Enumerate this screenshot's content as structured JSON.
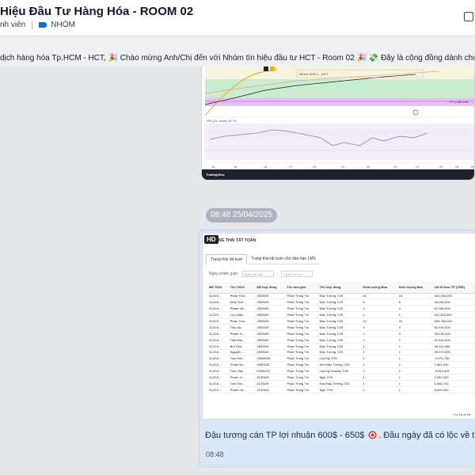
{
  "header": {
    "title": "Hiệu Đầu Tư Hàng Hóa - ROOM 02",
    "members_label": "nh viên",
    "group_label": "NHÓM"
  },
  "announcement": {
    "text": "dịch hàng hóa Tp.HCM - HCT, 🎉 Chào mừng Anh/Chị đến với Nhóm tín hiệu đầu tư HCT - Room 02 🎉  💸 Đây là cộng đồng dành cho các nhà đầu tư hà"
  },
  "chart_image": {
    "support_label": "Hỗ trợ SCB 1 - 1977",
    "tp_label": "TP 1,066,258",
    "rsi_label": "RSI (14, close) 51.79",
    "logo": "TradingView",
    "x_ticks": [
      "14",
      "15",
      "16",
      "17",
      "20",
      "21",
      "22",
      "23",
      "24",
      "25",
      "28",
      "29"
    ]
  },
  "timestamp_pill": "08:48 25/04/2025",
  "screenshot": {
    "badge": "HD",
    "title": "NG THÁI TẤT TOÁN",
    "tabs": [
      "Trạng thái tất toán",
      "Trạng thái tất toán chờ đáo hạn LMS"
    ],
    "filter_label": "Ngày phiên giao:",
    "filter_from": "Ngày bắt đầu",
    "filter_to": "Ngày kết thúc",
    "columns": [
      "Mã TK02",
      "Tên TK02",
      "Mã hợp đồng",
      "Tên môi giới",
      "Tên hợp đồng",
      "Khối lượng Mua",
      "Khối lượng Bán",
      "Lãi lỗ theo TP (VND)"
    ],
    "rows": [
      [
        "012C9...",
        "Phan Trun...",
        "ZSEN25",
        "Phan Trung Tín",
        "Đậu Tương 7/25",
        "10",
        "10",
        "181,200,000"
      ],
      [
        "012C8...",
        "Đinh Tuấ...",
        "ZSEN25",
        "Phan Trung Tín",
        "Đậu Tương 7/25",
        "5",
        "5",
        "83,950,000"
      ],
      [
        "012C8...",
        "Phạm Vă...",
        "ZSEN25",
        "Phan Trung Tín",
        "Đậu Tương 7/25",
        "4",
        "4",
        "67,080,000"
      ],
      [
        "012C9...",
        "Lưu Nhẫ...",
        "ZSEN25",
        "Phan Trung Tín",
        "Đậu Tương 7/25",
        "1",
        "1",
        "112,925,000"
      ],
      [
        "012C9...",
        "Phan Trun...",
        "ZSEN25",
        "Phan Trung Tín",
        "Đậu Tương 7/25",
        "10",
        "10",
        "165,780,000"
      ],
      [
        "012C8...",
        "Trần đa...",
        "ZSEN25",
        "Phan Trung Tín",
        "Đậu Tương 7/25",
        "3",
        "3",
        "62,930,000"
      ],
      [
        "012C8...",
        "Phạm Vi...",
        "ZSEN25",
        "Phan Trung Tín",
        "Đậu Tương 7/25",
        "2",
        "2",
        "33,230,000"
      ],
      [
        "012C8...",
        "Trần Đin...",
        "ZSEN25",
        "Phan Trung Tín",
        "Đậu Tương 7/25",
        "2",
        "2",
        "32,540,000"
      ],
      [
        "012C9...",
        "Bùi Tiến...",
        "ZSEN25",
        "Phan Trung Tín",
        "Đậu Tương 7/25",
        "1",
        "1",
        "30,110,000"
      ],
      [
        "012C8...",
        "Nguyễn ...",
        "ZSEN25",
        "Phan Trung Tín",
        "Đậu Tương 7/25",
        "1",
        "1",
        "29,070,000"
      ],
      [
        "012C8...",
        "Trần Đin...",
        "ZMWN25",
        "Phan Trung Tín",
        "Lúa Mỳ 7/25",
        "1",
        "1",
        "-2,571,750"
      ],
      [
        "012C8...",
        "Phạm Mi...",
        "ZMEN25",
        "Phan Trung Tín",
        "Khô Đậu Tương 7/25",
        "2",
        "2",
        "1,661,000"
      ],
      [
        "012C8...",
        "Trần Gia...",
        "KWEN25",
        "Phan Trung Tín",
        "Lúa Mỳ Kansas 7/25",
        "2",
        "2",
        "-5,812,500"
      ],
      [
        "012C8...",
        "Phạm Vi...",
        "ZCEN25",
        "Phan Trung Tín",
        "Ngô 7/25",
        "1",
        "1",
        "2,040,250"
      ],
      [
        "012C8...",
        "Trần Đin...",
        "ZLEN25",
        "Phan Trung Tín",
        "Dầu Đậu Tương 7/25",
        "1",
        "1",
        "1,060,700"
      ],
      [
        "012C9...",
        "Phạm Vă...",
        "ZCEN25",
        "Phan Trung Tín",
        "Ngô 7/25",
        "1",
        "1",
        "8,520,000"
      ]
    ],
    "row_profit_sign": [
      "g",
      "g",
      "g",
      "g",
      "g",
      "g",
      "g",
      "g",
      "g",
      "g",
      "r",
      "g",
      "r",
      "g",
      "g",
      "g"
    ],
    "pager": "1 to 16 of 16"
  },
  "message": {
    "caption": "Đậu tương cán TP lợi nhuận 600$ - 650$ 🎯. Đầu ngày đã có lộc về túi nhé",
    "time": "08:48"
  }
}
